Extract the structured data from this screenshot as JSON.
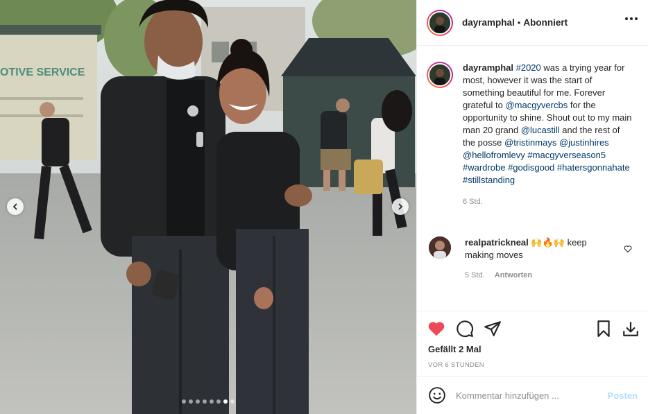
{
  "post": {
    "username": "dayramphal",
    "separator": "•",
    "follow_status": "Abonniert",
    "more_icon": "more-options-icon"
  },
  "media": {
    "sign_text": "OTIVE SERVICE",
    "carousel_dots": 8,
    "active_dot": 6
  },
  "caption": {
    "username": "dayramphal",
    "segments": [
      {
        "text": "#2020",
        "tag": true
      },
      {
        "text": " was a trying year for most, however it was the start of something beautiful for me. Forever grateful to ",
        "tag": false
      },
      {
        "text": "@macgyvercbs",
        "tag": true
      },
      {
        "text": " for the opportunity to shine. Shout out to my main man 20 grand ",
        "tag": false
      },
      {
        "text": "@lucastill",
        "tag": true
      },
      {
        "text": " and the rest of the posse ",
        "tag": false
      },
      {
        "text": "@tristinmays",
        "tag": true
      },
      {
        "text": " ",
        "tag": false
      },
      {
        "text": "@justinhires",
        "tag": true
      },
      {
        "text": " ",
        "tag": false
      },
      {
        "text": "@hellofromlevy",
        "tag": true
      },
      {
        "text": " ",
        "tag": false
      },
      {
        "text": "#macgyverseason5",
        "tag": true
      },
      {
        "text": " ",
        "tag": false
      },
      {
        "text": "#wardrobe",
        "tag": true
      },
      {
        "text": " ",
        "tag": false
      },
      {
        "text": "#godisgood",
        "tag": true
      },
      {
        "text": " ",
        "tag": false
      },
      {
        "text": "#hatersgonnahate",
        "tag": true
      },
      {
        "text": " ",
        "tag": false
      },
      {
        "text": "#stillstanding",
        "tag": true
      }
    ],
    "age": "6 Std."
  },
  "comment": {
    "username": "realpatrickneal",
    "emoji": "🙌🔥🙌",
    "text": " keep making moves",
    "age": "5 Std.",
    "reply_label": "Antworten"
  },
  "actions": {
    "likes": "Gefällt 2 Mal",
    "timestamp": "VOR 6 STUNDEN",
    "like_color": "#ed4956"
  },
  "add_comment": {
    "placeholder": "Kommentar hinzufügen ...",
    "post_label": "Posten",
    "post_color": "#b2dffc"
  }
}
